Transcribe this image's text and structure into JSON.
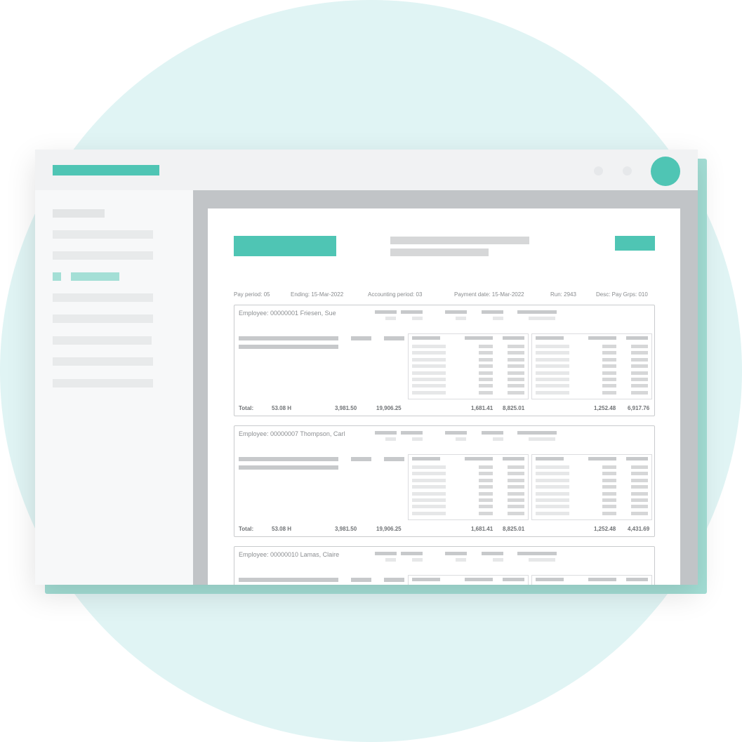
{
  "meta": {
    "pay_period": "Pay period: 05",
    "ending": "Ending: 15-Mar-2022",
    "accounting_period": "Accounting period: 03",
    "payment_date": "Payment date: 15-Mar-2022",
    "run": "Run: 2943",
    "desc": "Desc: Pay Grps: 010"
  },
  "employees": [
    {
      "label": "Employee: 00000001 Friesen, Sue",
      "total_label": "Total:",
      "hours": "53.08 H",
      "v1": "3,981.50",
      "v2": "19,906.25",
      "v3": "1,681.41",
      "v4": "8,825.01",
      "v5": "1,252.48",
      "v6": "6,917.76"
    },
    {
      "label": "Employee: 00000007 Thompson, Carl",
      "total_label": "Total:",
      "hours": "53.08 H",
      "v1": "3,981.50",
      "v2": "19,906.25",
      "v3": "1,681.41",
      "v4": "8,825.01",
      "v5": "1,252.48",
      "v6": "4,431.69"
    },
    {
      "label": "Employee: 00000010 Lamas, Claire"
    }
  ],
  "colors": {
    "accent": "#4fc5b4",
    "accent_light": "#a4dfd6",
    "background_circle": "#e0f4f4"
  },
  "icons": {
    "avatar": "user-avatar-icon"
  }
}
